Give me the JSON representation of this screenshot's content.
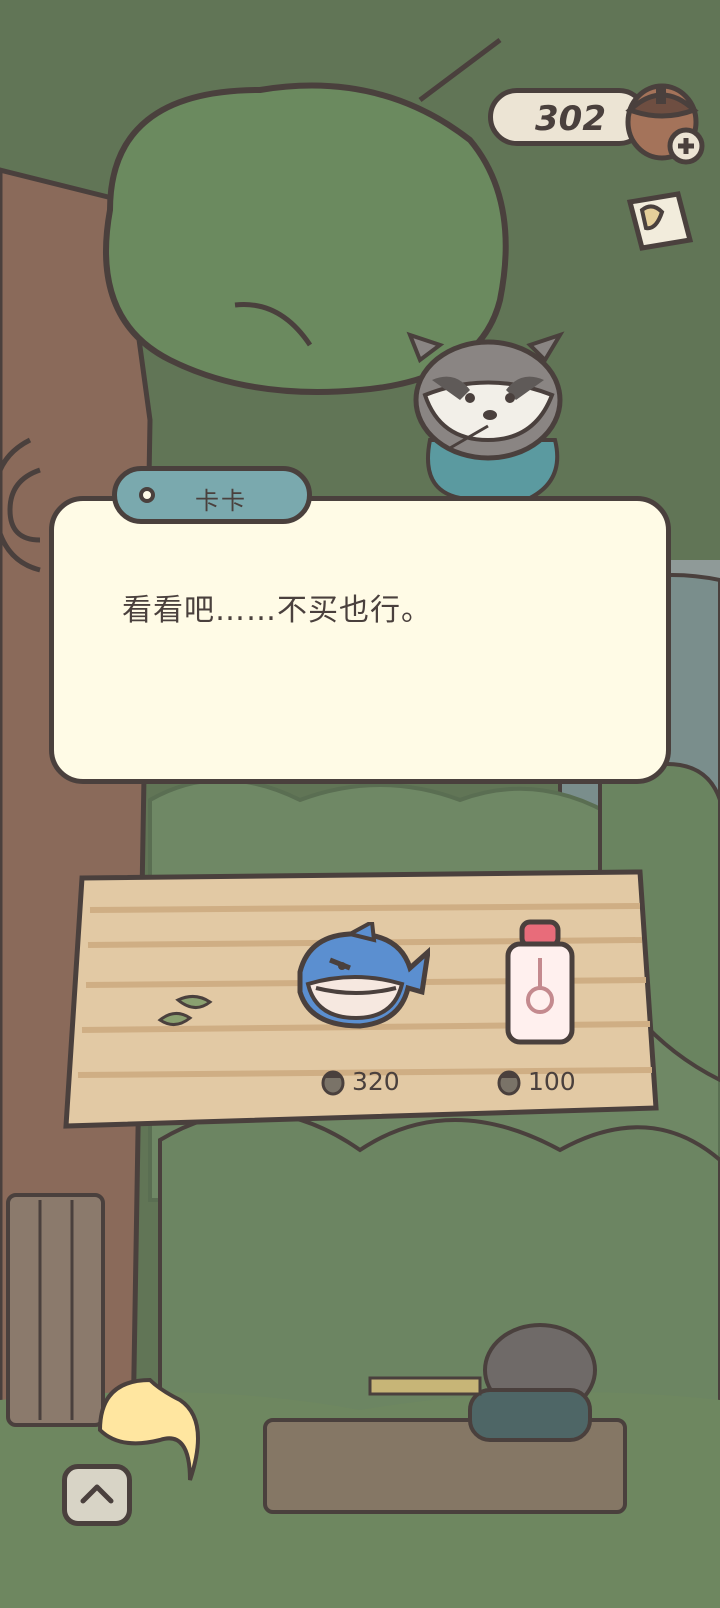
{
  "hud": {
    "acorn_count": "302",
    "acorn_icon": "acorn-plus-icon",
    "corner_icon": "notebook-icon"
  },
  "dialog": {
    "speaker": "卡卡",
    "text": "看看吧……不买也行。"
  },
  "shop": {
    "items": [
      {
        "icon": "shark-toy-icon",
        "price": "320"
      },
      {
        "icon": "glass-bottle-icon",
        "price": "100"
      }
    ],
    "price_icon": "acorn-icon"
  },
  "controls": {
    "expand_icon": "chevron-up-icon"
  },
  "colors": {
    "outline": "#4a403d",
    "dialog_bg": "#fffbe6",
    "tab": "#7aa9ae",
    "forest_dark": "#5f7355",
    "table_wood": "#e2c9a4"
  }
}
